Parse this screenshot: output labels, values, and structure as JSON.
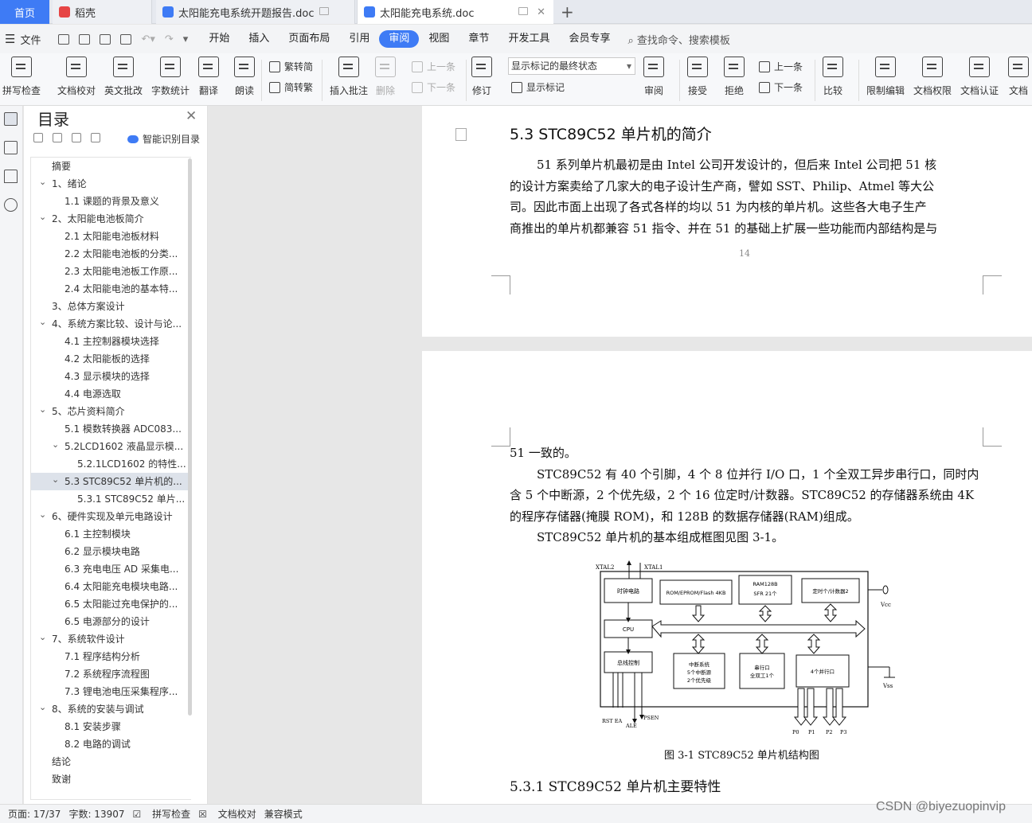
{
  "tabs": {
    "home": "首页",
    "t1": "稻壳",
    "t2": "太阳能充电系统开题报告.doc",
    "t3": "太阳能充电系统.doc"
  },
  "menu": {
    "file": "文件",
    "items": [
      "开始",
      "插入",
      "页面布局",
      "引用",
      "审阅",
      "视图",
      "章节",
      "开发工具",
      "会员专享"
    ],
    "search": "查找命令、搜索模板"
  },
  "ribbon": {
    "spell": "拼写检查",
    "proof": "文档校对",
    "en_review": "英文批改",
    "word_count": "字数统计",
    "translate": "翻译",
    "read": "朗读",
    "trad": "繁转简",
    "simp": "简转繁",
    "insert_comment": "插入批注",
    "delete": "删除",
    "prev_comment": "上一条",
    "next_comment": "下一条",
    "revise": "修订",
    "markup_state": "显示标记的最终状态",
    "show_markup": "显示标记",
    "review": "审阅",
    "accept": "接受",
    "reject": "拒绝",
    "prev": "上一条",
    "next": "下一条",
    "compare": "比较",
    "restrict": "限制编辑",
    "permission": "文档权限",
    "certify": "文档认证",
    "more": "文档"
  },
  "toc": {
    "title": "目录",
    "smart": "智能识别目录",
    "items": [
      {
        "label": "摘要",
        "level": 1,
        "arrow": ""
      },
      {
        "label": "1、绪论",
        "level": 1,
        "arrow": "v"
      },
      {
        "label": "1.1 课题的背景及意义",
        "level": 2,
        "arrow": ""
      },
      {
        "label": "2、太阳能电池板简介",
        "level": 1,
        "arrow": "v"
      },
      {
        "label": "2.1 太阳能电池板材料",
        "level": 2,
        "arrow": ""
      },
      {
        "label": "2.2 太阳能电池板的分类...",
        "level": 2,
        "arrow": ""
      },
      {
        "label": "2.3 太阳能电池板工作原...",
        "level": 2,
        "arrow": ""
      },
      {
        "label": "2.4 太阳能电池的基本特...",
        "level": 2,
        "arrow": ""
      },
      {
        "label": "3、总体方案设计",
        "level": 1,
        "arrow": ""
      },
      {
        "label": "4、系统方案比较、设计与论...",
        "level": 1,
        "arrow": "v"
      },
      {
        "label": "4.1 主控制器模块选择",
        "level": 2,
        "arrow": ""
      },
      {
        "label": "4.2 太阳能板的选择",
        "level": 2,
        "arrow": ""
      },
      {
        "label": "4.3 显示模块的选择",
        "level": 2,
        "arrow": ""
      },
      {
        "label": "4.4 电源选取",
        "level": 2,
        "arrow": ""
      },
      {
        "label": "5、芯片资料简介",
        "level": 1,
        "arrow": "v"
      },
      {
        "label": "5.1 模数转换器 ADC083...",
        "level": 2,
        "arrow": ""
      },
      {
        "label": "5.2LCD1602 液晶显示模...",
        "level": 2,
        "arrow": "v"
      },
      {
        "label": "5.2.1LCD1602 的特性...",
        "level": 3,
        "arrow": ""
      },
      {
        "label": "5.3 STC89C52 单片机的...",
        "level": 2,
        "arrow": "v",
        "selected": true
      },
      {
        "label": "5.3.1 STC89C52 单片...",
        "level": 3,
        "arrow": ""
      },
      {
        "label": "6、硬件实现及单元电路设计",
        "level": 1,
        "arrow": "v"
      },
      {
        "label": "6.1 主控制模块",
        "level": 2,
        "arrow": ""
      },
      {
        "label": "6.2 显示模块电路",
        "level": 2,
        "arrow": ""
      },
      {
        "label": "6.3 充电电压 AD 采集电...",
        "level": 2,
        "arrow": ""
      },
      {
        "label": "6.4 太阳能充电模块电路...",
        "level": 2,
        "arrow": ""
      },
      {
        "label": "6.5 太阳能过充电保护的...",
        "level": 2,
        "arrow": ""
      },
      {
        "label": "6.5 电源部分的设计",
        "level": 2,
        "arrow": ""
      },
      {
        "label": "7、系统软件设计",
        "level": 1,
        "arrow": "v"
      },
      {
        "label": "7.1 程序结构分析",
        "level": 2,
        "arrow": ""
      },
      {
        "label": "7.2 系统程序流程图",
        "level": 2,
        "arrow": ""
      },
      {
        "label": "7.3 锂电池电压采集程序...",
        "level": 2,
        "arrow": ""
      },
      {
        "label": "8、系统的安装与调试",
        "level": 1,
        "arrow": "v"
      },
      {
        "label": "8.1 安装步骤",
        "level": 2,
        "arrow": ""
      },
      {
        "label": "8.2 电路的调试",
        "level": 2,
        "arrow": ""
      },
      {
        "label": "结论",
        "level": 1,
        "arrow": ""
      },
      {
        "label": "致谢",
        "level": 1,
        "arrow": ""
      }
    ]
  },
  "doc": {
    "heading": "5.3 STC89C52 单片机的简介",
    "p1": [
      "51 系列单片机最初是由 Intel 公司开发设计的，但后来 Intel 公司把 51 核",
      "的设计方案卖给了几家大的电子设计生产商，譬如 SST、Philip、Atmel 等大公",
      "司。因此市面上出现了各式各样的均以 51 为内核的单片机。这些各大电子生产",
      "商推出的单片机都兼容 51 指令、并在 51 的基础上扩展一些功能而内部结构是与"
    ],
    "page_number": "14",
    "p2": [
      "51 一致的。",
      "STC89C52 有 40 个引脚，4 个 8 位并行 I/O 口，1 个全双工异步串行口，同时内",
      "含 5 个中断源，2 个优先级，2 个 16 位定时/计数器。STC89C52 的存储器系统由 4K",
      "的程序存储器(掩膜 ROM)，和 128B 的数据存储器(RAM)组成。",
      "STC89C52 单片机的基本组成框图见图 3-1。"
    ],
    "figure": {
      "xtal2": "XTAL2",
      "xtal1": "XTAL1",
      "clock": "时钟电路",
      "rom": "ROM/EPROM/Flash 4KB",
      "ram1": "RAM128B",
      "ram2": "SFR 21个",
      "timer": "定时个/计数器2",
      "vcc": "Vcc",
      "cpu": "CPU",
      "bus": "总线控制",
      "int1": "中断系统",
      "int2": "5个中断源",
      "int3": "2个优先级",
      "serial1": "串行口",
      "serial2": "全双工1个",
      "parallel": "4个并行口",
      "vss": "Vss",
      "pins": "RST EA",
      "ale": "ALE",
      "psen": "PSEN",
      "p0": "P0",
      "p1": "P1",
      "p2": "P2",
      "p3": "P3"
    },
    "caption": "图 3-1  STC89C52 单片机结构图",
    "heading2": "5.3.1 STC89C52 单片机主要特性"
  },
  "status": {
    "page": "页面: 17/37",
    "words": "字数: 13907",
    "spell": "拼写检查",
    "proof": "文档校对",
    "compat": "兼容模式"
  },
  "watermark": "CSDN @biyezuopinvip"
}
